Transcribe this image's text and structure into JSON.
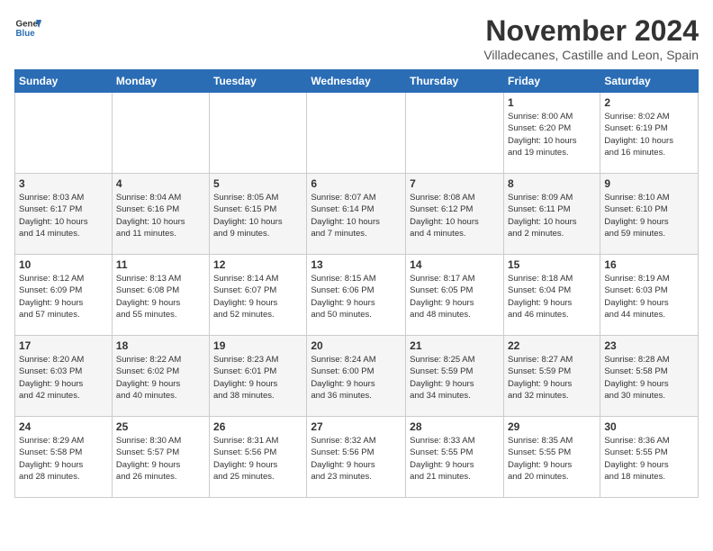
{
  "logo": {
    "line1": "General",
    "line2": "Blue"
  },
  "header": {
    "month": "November 2024",
    "location": "Villadecanes, Castille and Leon, Spain"
  },
  "weekdays": [
    "Sunday",
    "Monday",
    "Tuesday",
    "Wednesday",
    "Thursday",
    "Friday",
    "Saturday"
  ],
  "weeks": [
    [
      {
        "day": "",
        "info": ""
      },
      {
        "day": "",
        "info": ""
      },
      {
        "day": "",
        "info": ""
      },
      {
        "day": "",
        "info": ""
      },
      {
        "day": "",
        "info": ""
      },
      {
        "day": "1",
        "info": "Sunrise: 8:00 AM\nSunset: 6:20 PM\nDaylight: 10 hours\nand 19 minutes."
      },
      {
        "day": "2",
        "info": "Sunrise: 8:02 AM\nSunset: 6:19 PM\nDaylight: 10 hours\nand 16 minutes."
      }
    ],
    [
      {
        "day": "3",
        "info": "Sunrise: 8:03 AM\nSunset: 6:17 PM\nDaylight: 10 hours\nand 14 minutes."
      },
      {
        "day": "4",
        "info": "Sunrise: 8:04 AM\nSunset: 6:16 PM\nDaylight: 10 hours\nand 11 minutes."
      },
      {
        "day": "5",
        "info": "Sunrise: 8:05 AM\nSunset: 6:15 PM\nDaylight: 10 hours\nand 9 minutes."
      },
      {
        "day": "6",
        "info": "Sunrise: 8:07 AM\nSunset: 6:14 PM\nDaylight: 10 hours\nand 7 minutes."
      },
      {
        "day": "7",
        "info": "Sunrise: 8:08 AM\nSunset: 6:12 PM\nDaylight: 10 hours\nand 4 minutes."
      },
      {
        "day": "8",
        "info": "Sunrise: 8:09 AM\nSunset: 6:11 PM\nDaylight: 10 hours\nand 2 minutes."
      },
      {
        "day": "9",
        "info": "Sunrise: 8:10 AM\nSunset: 6:10 PM\nDaylight: 9 hours\nand 59 minutes."
      }
    ],
    [
      {
        "day": "10",
        "info": "Sunrise: 8:12 AM\nSunset: 6:09 PM\nDaylight: 9 hours\nand 57 minutes."
      },
      {
        "day": "11",
        "info": "Sunrise: 8:13 AM\nSunset: 6:08 PM\nDaylight: 9 hours\nand 55 minutes."
      },
      {
        "day": "12",
        "info": "Sunrise: 8:14 AM\nSunset: 6:07 PM\nDaylight: 9 hours\nand 52 minutes."
      },
      {
        "day": "13",
        "info": "Sunrise: 8:15 AM\nSunset: 6:06 PM\nDaylight: 9 hours\nand 50 minutes."
      },
      {
        "day": "14",
        "info": "Sunrise: 8:17 AM\nSunset: 6:05 PM\nDaylight: 9 hours\nand 48 minutes."
      },
      {
        "day": "15",
        "info": "Sunrise: 8:18 AM\nSunset: 6:04 PM\nDaylight: 9 hours\nand 46 minutes."
      },
      {
        "day": "16",
        "info": "Sunrise: 8:19 AM\nSunset: 6:03 PM\nDaylight: 9 hours\nand 44 minutes."
      }
    ],
    [
      {
        "day": "17",
        "info": "Sunrise: 8:20 AM\nSunset: 6:03 PM\nDaylight: 9 hours\nand 42 minutes."
      },
      {
        "day": "18",
        "info": "Sunrise: 8:22 AM\nSunset: 6:02 PM\nDaylight: 9 hours\nand 40 minutes."
      },
      {
        "day": "19",
        "info": "Sunrise: 8:23 AM\nSunset: 6:01 PM\nDaylight: 9 hours\nand 38 minutes."
      },
      {
        "day": "20",
        "info": "Sunrise: 8:24 AM\nSunset: 6:00 PM\nDaylight: 9 hours\nand 36 minutes."
      },
      {
        "day": "21",
        "info": "Sunrise: 8:25 AM\nSunset: 5:59 PM\nDaylight: 9 hours\nand 34 minutes."
      },
      {
        "day": "22",
        "info": "Sunrise: 8:27 AM\nSunset: 5:59 PM\nDaylight: 9 hours\nand 32 minutes."
      },
      {
        "day": "23",
        "info": "Sunrise: 8:28 AM\nSunset: 5:58 PM\nDaylight: 9 hours\nand 30 minutes."
      }
    ],
    [
      {
        "day": "24",
        "info": "Sunrise: 8:29 AM\nSunset: 5:58 PM\nDaylight: 9 hours\nand 28 minutes."
      },
      {
        "day": "25",
        "info": "Sunrise: 8:30 AM\nSunset: 5:57 PM\nDaylight: 9 hours\nand 26 minutes."
      },
      {
        "day": "26",
        "info": "Sunrise: 8:31 AM\nSunset: 5:56 PM\nDaylight: 9 hours\nand 25 minutes."
      },
      {
        "day": "27",
        "info": "Sunrise: 8:32 AM\nSunset: 5:56 PM\nDaylight: 9 hours\nand 23 minutes."
      },
      {
        "day": "28",
        "info": "Sunrise: 8:33 AM\nSunset: 5:55 PM\nDaylight: 9 hours\nand 21 minutes."
      },
      {
        "day": "29",
        "info": "Sunrise: 8:35 AM\nSunset: 5:55 PM\nDaylight: 9 hours\nand 20 minutes."
      },
      {
        "day": "30",
        "info": "Sunrise: 8:36 AM\nSunset: 5:55 PM\nDaylight: 9 hours\nand 18 minutes."
      }
    ]
  ]
}
